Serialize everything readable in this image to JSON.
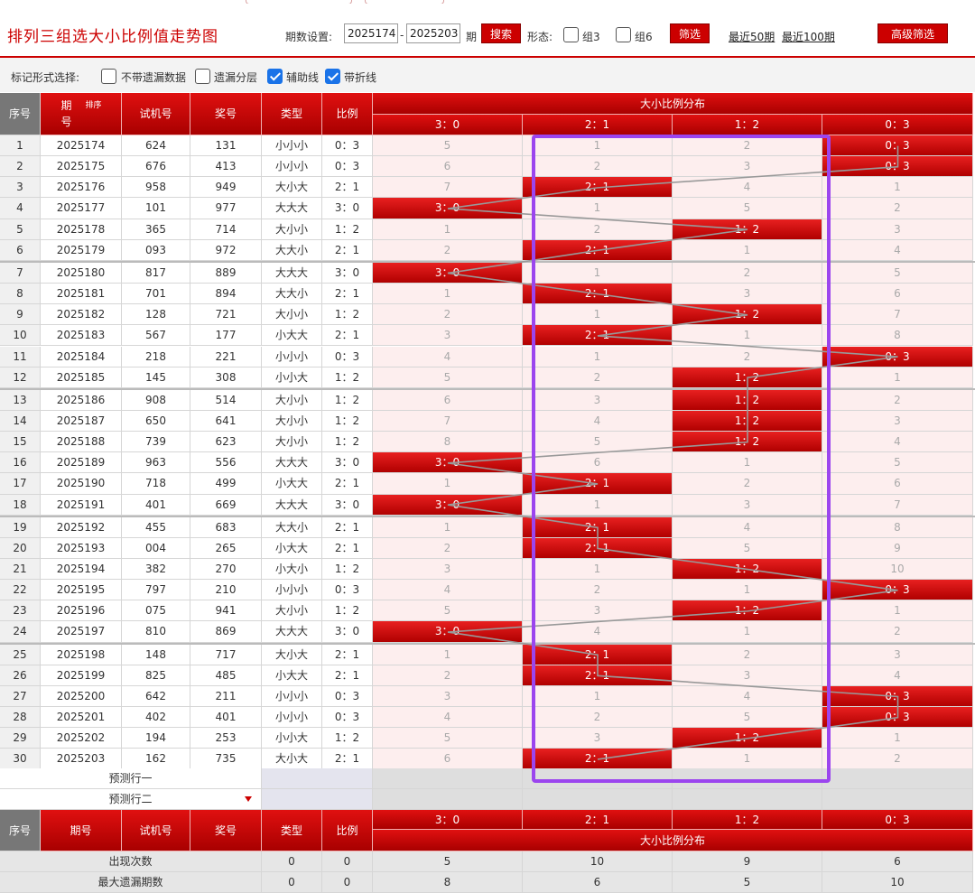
{
  "page": {
    "title": "排列三组选大小比例值走势图",
    "period_label": "期数设置:",
    "period_from": "2025174",
    "period_dash": "-",
    "period_to": "2025203",
    "period_unit": "期",
    "search_btn": "搜索",
    "shape_label": "形态:",
    "group3": "组3",
    "group6": "组6",
    "filter_btn": "筛选",
    "recent50": "最近50期",
    "recent100": "最近100期",
    "advanced_btn": "高级筛选"
  },
  "markbar": {
    "label": "标记形式选择:",
    "options": [
      {
        "label": "不带遗漏数据",
        "checked": false
      },
      {
        "label": "遗漏分层",
        "checked": false
      },
      {
        "label": "辅助线",
        "checked": true
      },
      {
        "label": "带折线",
        "checked": true
      }
    ]
  },
  "table": {
    "headers": {
      "seq": "序号",
      "issue": "期号",
      "sort": "排序",
      "trial": "试机号",
      "prize": "奖号",
      "type": "类型",
      "ratio": "比例",
      "dist": "大小比例分布"
    },
    "dist_cols": [
      "3：0",
      "2：1",
      "1：2",
      "0：3"
    ],
    "rows": [
      {
        "seq": "1",
        "issue": "2025174",
        "trial": "624",
        "prize": "131",
        "type": "小小小",
        "ratio": "0：3",
        "hit": 3,
        "miss": [
          "5",
          "1",
          "2",
          ""
        ]
      },
      {
        "seq": "2",
        "issue": "2025175",
        "trial": "676",
        "prize": "413",
        "type": "小小小",
        "ratio": "0：3",
        "hit": 3,
        "miss": [
          "6",
          "2",
          "3",
          ""
        ]
      },
      {
        "seq": "3",
        "issue": "2025176",
        "trial": "958",
        "prize": "949",
        "type": "大小大",
        "ratio": "2：1",
        "hit": 1,
        "miss": [
          "7",
          "",
          "4",
          "1"
        ]
      },
      {
        "seq": "4",
        "issue": "2025177",
        "trial": "101",
        "prize": "977",
        "type": "大大大",
        "ratio": "3：0",
        "hit": 0,
        "miss": [
          "",
          "1",
          "5",
          "2"
        ]
      },
      {
        "seq": "5",
        "issue": "2025178",
        "trial": "365",
        "prize": "714",
        "type": "大小小",
        "ratio": "1：2",
        "hit": 2,
        "miss": [
          "1",
          "2",
          "",
          "3"
        ]
      },
      {
        "seq": "6",
        "issue": "2025179",
        "trial": "093",
        "prize": "972",
        "type": "大大小",
        "ratio": "2：1",
        "hit": 1,
        "miss": [
          "2",
          "",
          "1",
          "4"
        ]
      },
      {
        "seq": "7",
        "issue": "2025180",
        "trial": "817",
        "prize": "889",
        "type": "大大大",
        "ratio": "3：0",
        "hit": 0,
        "miss": [
          "",
          "1",
          "2",
          "5"
        ]
      },
      {
        "seq": "8",
        "issue": "2025181",
        "trial": "701",
        "prize": "894",
        "type": "大大小",
        "ratio": "2：1",
        "hit": 1,
        "miss": [
          "1",
          "",
          "3",
          "6"
        ]
      },
      {
        "seq": "9",
        "issue": "2025182",
        "trial": "128",
        "prize": "721",
        "type": "大小小",
        "ratio": "1：2",
        "hit": 2,
        "miss": [
          "2",
          "1",
          "",
          "7"
        ]
      },
      {
        "seq": "10",
        "issue": "2025183",
        "trial": "567",
        "prize": "177",
        "type": "小大大",
        "ratio": "2：1",
        "hit": 1,
        "miss": [
          "3",
          "",
          "1",
          "8"
        ]
      },
      {
        "seq": "11",
        "issue": "2025184",
        "trial": "218",
        "prize": "221",
        "type": "小小小",
        "ratio": "0：3",
        "hit": 3,
        "miss": [
          "4",
          "1",
          "2",
          ""
        ]
      },
      {
        "seq": "12",
        "issue": "2025185",
        "trial": "145",
        "prize": "308",
        "type": "小小大",
        "ratio": "1：2",
        "hit": 2,
        "miss": [
          "5",
          "2",
          "",
          "1"
        ]
      },
      {
        "seq": "13",
        "issue": "2025186",
        "trial": "908",
        "prize": "514",
        "type": "大小小",
        "ratio": "1：2",
        "hit": 2,
        "miss": [
          "6",
          "3",
          "",
          "2"
        ]
      },
      {
        "seq": "14",
        "issue": "2025187",
        "trial": "650",
        "prize": "641",
        "type": "大小小",
        "ratio": "1：2",
        "hit": 2,
        "miss": [
          "7",
          "4",
          "",
          "3"
        ]
      },
      {
        "seq": "15",
        "issue": "2025188",
        "trial": "739",
        "prize": "623",
        "type": "大小小",
        "ratio": "1：2",
        "hit": 2,
        "miss": [
          "8",
          "5",
          "",
          "4"
        ]
      },
      {
        "seq": "16",
        "issue": "2025189",
        "trial": "963",
        "prize": "556",
        "type": "大大大",
        "ratio": "3：0",
        "hit": 0,
        "miss": [
          "",
          "6",
          "1",
          "5"
        ]
      },
      {
        "seq": "17",
        "issue": "2025190",
        "trial": "718",
        "prize": "499",
        "type": "小大大",
        "ratio": "2：1",
        "hit": 1,
        "miss": [
          "1",
          "",
          "2",
          "6"
        ]
      },
      {
        "seq": "18",
        "issue": "2025191",
        "trial": "401",
        "prize": "669",
        "type": "大大大",
        "ratio": "3：0",
        "hit": 0,
        "miss": [
          "",
          "1",
          "3",
          "7"
        ]
      },
      {
        "seq": "19",
        "issue": "2025192",
        "trial": "455",
        "prize": "683",
        "type": "大大小",
        "ratio": "2：1",
        "hit": 1,
        "miss": [
          "1",
          "",
          "4",
          "8"
        ]
      },
      {
        "seq": "20",
        "issue": "2025193",
        "trial": "004",
        "prize": "265",
        "type": "小大大",
        "ratio": "2：1",
        "hit": 1,
        "miss": [
          "2",
          "",
          "5",
          "9"
        ]
      },
      {
        "seq": "21",
        "issue": "2025194",
        "trial": "382",
        "prize": "270",
        "type": "小大小",
        "ratio": "1：2",
        "hit": 2,
        "miss": [
          "3",
          "1",
          "",
          "10"
        ]
      },
      {
        "seq": "22",
        "issue": "2025195",
        "trial": "797",
        "prize": "210",
        "type": "小小小",
        "ratio": "0：3",
        "hit": 3,
        "miss": [
          "4",
          "2",
          "1",
          ""
        ]
      },
      {
        "seq": "23",
        "issue": "2025196",
        "trial": "075",
        "prize": "941",
        "type": "大小小",
        "ratio": "1：2",
        "hit": 2,
        "miss": [
          "5",
          "3",
          "",
          "1"
        ]
      },
      {
        "seq": "24",
        "issue": "2025197",
        "trial": "810",
        "prize": "869",
        "type": "大大大",
        "ratio": "3：0",
        "hit": 0,
        "miss": [
          "",
          "4",
          "1",
          "2"
        ]
      },
      {
        "seq": "25",
        "issue": "2025198",
        "trial": "148",
        "prize": "717",
        "type": "大小大",
        "ratio": "2：1",
        "hit": 1,
        "miss": [
          "1",
          "",
          "2",
          "3"
        ]
      },
      {
        "seq": "26",
        "issue": "2025199",
        "trial": "825",
        "prize": "485",
        "type": "小大大",
        "ratio": "2：1",
        "hit": 1,
        "miss": [
          "2",
          "",
          "3",
          "4"
        ]
      },
      {
        "seq": "27",
        "issue": "2025200",
        "trial": "642",
        "prize": "211",
        "type": "小小小",
        "ratio": "0：3",
        "hit": 3,
        "miss": [
          "3",
          "1",
          "4",
          ""
        ]
      },
      {
        "seq": "28",
        "issue": "2025201",
        "trial": "402",
        "prize": "401",
        "type": "小小小",
        "ratio": "0：3",
        "hit": 3,
        "miss": [
          "4",
          "2",
          "5",
          ""
        ]
      },
      {
        "seq": "29",
        "issue": "2025202",
        "trial": "194",
        "prize": "253",
        "type": "小小大",
        "ratio": "1：2",
        "hit": 2,
        "miss": [
          "5",
          "3",
          "",
          "1"
        ]
      },
      {
        "seq": "30",
        "issue": "2025203",
        "trial": "162",
        "prize": "735",
        "type": "大小大",
        "ratio": "2：1",
        "hit": 1,
        "miss": [
          "6",
          "",
          "1",
          "2"
        ]
      }
    ],
    "predict1": "预测行一",
    "predict2": "预测行二",
    "summary": [
      {
        "label": "出现次数",
        "type": "0",
        "ratio": "0",
        "vals": [
          "5",
          "10",
          "9",
          "6"
        ]
      },
      {
        "label": "最大遗漏期数",
        "type": "0",
        "ratio": "0",
        "vals": [
          "8",
          "6",
          "5",
          "10"
        ]
      }
    ]
  },
  "colors": {
    "accent": "#cc0000",
    "highlight_box": "#9b45ee",
    "trend_line": "#999999"
  }
}
